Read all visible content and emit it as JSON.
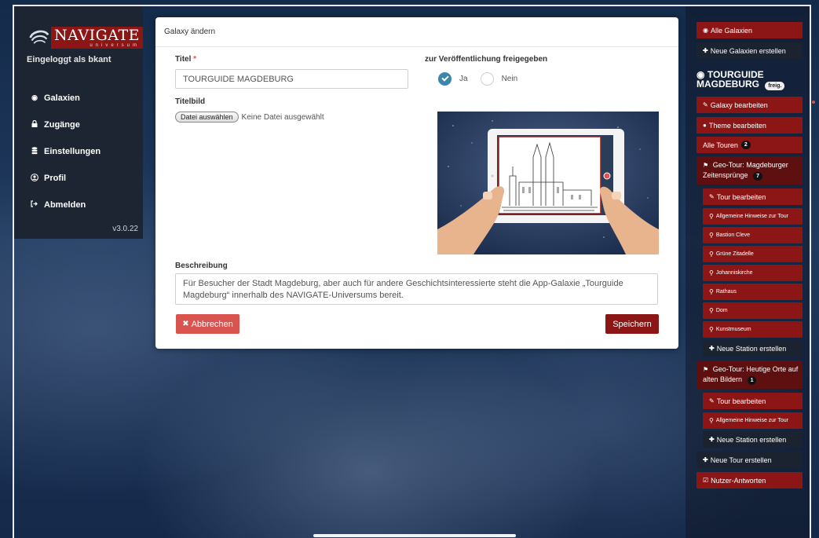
{
  "app": {
    "logo_title": "NAVIGATE",
    "logo_sub": "universum",
    "login_text": "Eingeloggt als bkant",
    "version": "v3.0.22"
  },
  "nav": {
    "items": [
      {
        "icon": "target-icon",
        "label": "Galaxien"
      },
      {
        "icon": "lock-icon",
        "label": "Zugänge"
      },
      {
        "icon": "database-icon",
        "label": "Einstellungen"
      },
      {
        "icon": "user-icon",
        "label": "Profil"
      },
      {
        "icon": "logout-icon",
        "label": "Abmelden"
      }
    ]
  },
  "modal": {
    "title": "Galaxy ändern",
    "title_label": "Titel",
    "required_mark": "*",
    "title_value": "TOURGUIDE MAGDEBURG",
    "publish_label": "zur Veröffentlichung freigegeben",
    "radio_yes": "Ja",
    "radio_no": "Nein",
    "publish_selected": "Ja",
    "image_label": "Titelbild",
    "file_button": "Datei auswählen",
    "file_status": "Keine Datei ausgewählt",
    "desc_label": "Beschreibung",
    "desc_value": "Für Besucher der Stadt Magdeburg, aber auch für andere Geschichtsinteressierte steht die App-Galaxie „Tourguide Magdeburg“ innerhalb des NAVIGATE-Universums bereit.",
    "cancel_label": "Abbrechen",
    "save_label": "Speichern"
  },
  "right": {
    "all_galaxies": "Alle Galaxien",
    "new_galaxies": "Neue Galaxien erstellen",
    "galaxy_title": "TOURGUIDE MAGDEBURG",
    "galaxy_badge": "freig.",
    "edit_galaxy": "Galaxy bearbeiten",
    "edit_theme": "Theme bearbeiten",
    "all_tours": "Alle Touren",
    "all_tours_count": "2",
    "tour1": {
      "title": "Geo-Tour: Magdeburger Zeitensprünge",
      "count": "7",
      "edit": "Tour bearbeiten",
      "stations": [
        "Allgemeine Hinweise zur Tour",
        "Bastion Cleve",
        "Grüne Zitadelle",
        "Johanniskirche",
        "Rathaus",
        "Dom",
        "Kunstmuseum"
      ],
      "new_station": "Neue Station erstellen"
    },
    "tour2": {
      "title": "Geo-Tour: Heutige Orte auf alten Bildern",
      "count": "1",
      "edit": "Tour bearbeiten",
      "stations": [
        "Allgemeine Hinweise zur Tour"
      ],
      "new_station": "Neue Station erstellen"
    },
    "new_tour": "Neue Tour erstellen",
    "user_answers": "Nutzer-Antworten"
  },
  "colors": {
    "brand_red": "#8c1616",
    "danger": "#d9534f",
    "radio_blue": "#3a87ad",
    "sidebar_dark": "#1d2532"
  }
}
